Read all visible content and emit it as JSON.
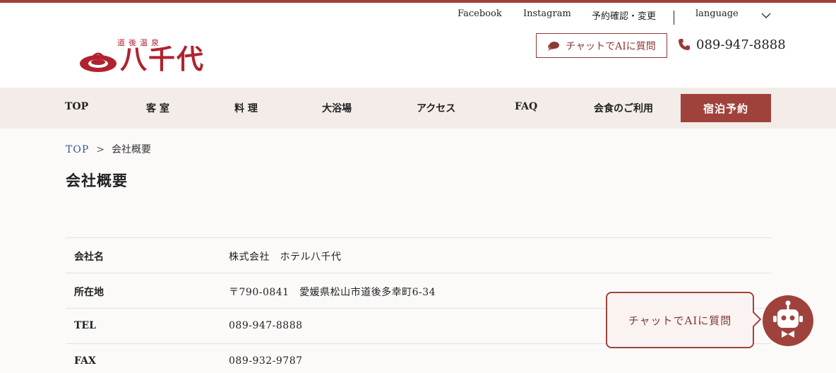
{
  "util": {
    "facebook": "Facebook",
    "instagram": "Instagram",
    "reservation_check": "予約確認・変更",
    "language": "language"
  },
  "logo": {
    "subtitle": "道後温泉",
    "name": "八千代"
  },
  "header": {
    "chat_label": "チャットでAIに質問",
    "phone": "089-947-8888"
  },
  "nav": {
    "items": [
      "TOP",
      "客 室",
      "料 理",
      "大浴場",
      "アクセス",
      "FAQ",
      "会食のご利用"
    ],
    "reserve": "宿泊予約"
  },
  "breadcrumb": {
    "home": "TOP",
    "separator": ">",
    "current": "会社概要"
  },
  "page_title": "会社概要",
  "company_info": [
    {
      "label": "会社名",
      "value": "株式会社　ホテル八千代"
    },
    {
      "label": "所在地",
      "value": "〒790-0841　愛媛県松山市道後多幸町6-34"
    },
    {
      "label": "TEL",
      "value": "089-947-8888"
    },
    {
      "label": "FAX",
      "value": "089-932-9787"
    }
  ],
  "chat_widget": {
    "label": "チャットでAIに質問"
  },
  "colors": {
    "accent": "#a0423c",
    "logo_red": "#b1222f",
    "nav_bg": "#f3ece8"
  }
}
